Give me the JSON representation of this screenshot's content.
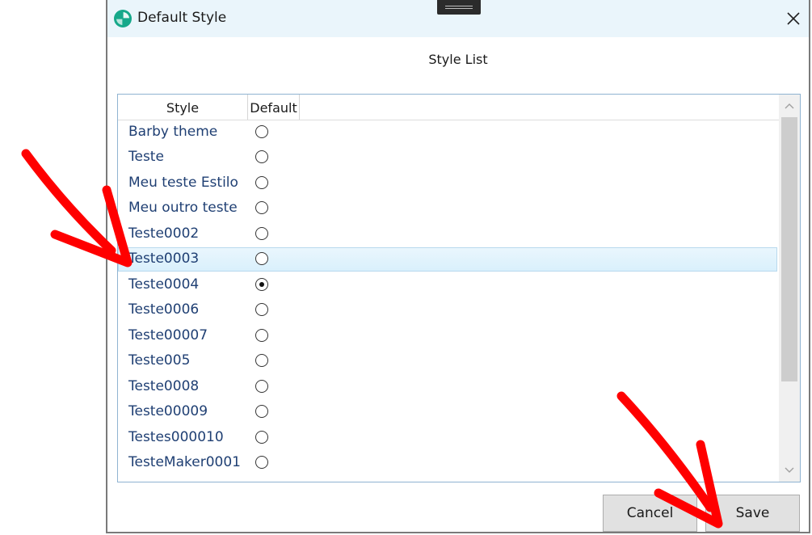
{
  "window": {
    "title": "Default Style",
    "section_title": "Style List"
  },
  "table": {
    "columns": [
      "Style",
      "Default"
    ],
    "rows": [
      {
        "name": "Barby theme",
        "default": false
      },
      {
        "name": "Teste",
        "default": false
      },
      {
        "name": "Meu teste Estilo",
        "default": false
      },
      {
        "name": "Meu outro teste",
        "default": false
      },
      {
        "name": "Teste0002",
        "default": false
      },
      {
        "name": "Teste0003",
        "default": false,
        "hovered": true
      },
      {
        "name": "Teste0004",
        "default": true
      },
      {
        "name": "Teste0006",
        "default": false
      },
      {
        "name": "Teste00007",
        "default": false
      },
      {
        "name": "Teste005",
        "default": false
      },
      {
        "name": "Teste0008",
        "default": false
      },
      {
        "name": "Teste00009",
        "default": false
      },
      {
        "name": "Testes000010",
        "default": false
      },
      {
        "name": "TesteMaker0001",
        "default": false
      }
    ]
  },
  "buttons": {
    "cancel": "Cancel",
    "save": "Save"
  },
  "icons": {
    "app": "app-logo-icon",
    "close": "close-icon",
    "scroll_up": "chevron-up-icon",
    "scroll_down": "chevron-down-icon"
  },
  "annotations": {
    "arrow_color": "#ff0000"
  }
}
